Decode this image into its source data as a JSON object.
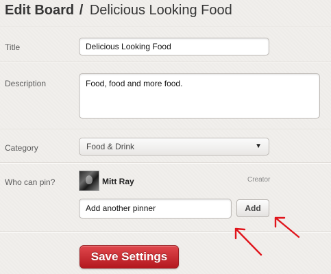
{
  "header": {
    "title": "Edit Board",
    "separator": "/",
    "board_name": "Delicious Looking Food"
  },
  "form": {
    "title_label": "Title",
    "title_value": "Delicious Looking Food",
    "description_label": "Description",
    "description_value": "Food, food and more food.",
    "category_label": "Category",
    "category_value": "Food & Drink",
    "who_can_pin_label": "Who can pin?",
    "pinner": {
      "name": "Mitt Ray",
      "role": "Creator"
    },
    "add_pinner_value": "Add another pinner",
    "add_label": "Add",
    "save_label": "Save Settings"
  },
  "colors": {
    "save_button": "#c8242b",
    "annotation_arrow": "#e0141b",
    "background": "#f1efec"
  },
  "icons": {
    "dropdown": "triangle-down-icon",
    "annotation": "red-arrow-icon"
  }
}
